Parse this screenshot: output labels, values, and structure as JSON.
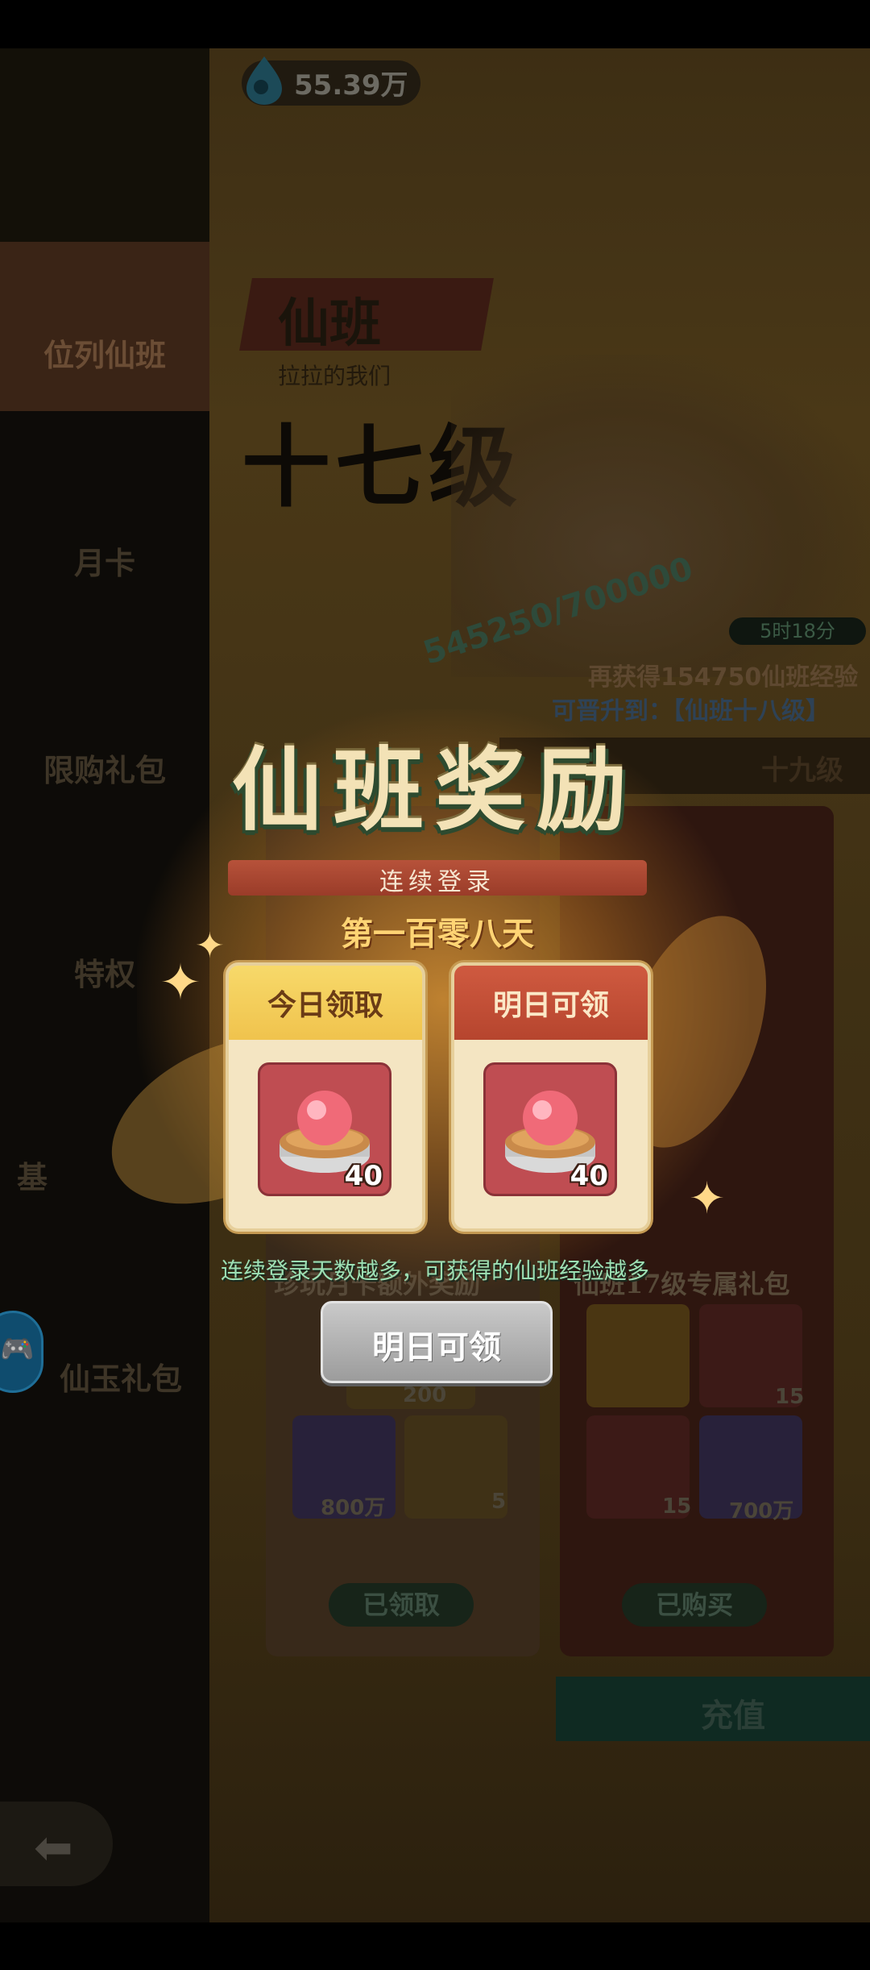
{
  "currency": {
    "value": "55.39万",
    "icon": "drop-icon"
  },
  "sidebar": {
    "items": [
      {
        "label": "位列仙班",
        "active": true
      },
      {
        "label": "月卡"
      },
      {
        "label": "限购礼包"
      },
      {
        "label": "特权"
      },
      {
        "label": "基"
      },
      {
        "label": "仙玉礼包"
      }
    ]
  },
  "background": {
    "title": "仙班",
    "subtitle": "拉拉的我们",
    "level": "十七级",
    "progress": "545250/700000",
    "timer": "5时18分",
    "exp_hint": "再获得154750仙班经验",
    "upgrade_hint": "可晋升到：【仙班十八级】",
    "level_right": "十九级",
    "left_panel_label": "珍玩月卡额外奖励",
    "right_panel_label": "仙班17级专属礼包",
    "left_items": [
      {
        "value": "200"
      },
      {
        "value": "800万"
      },
      {
        "value": "5"
      }
    ],
    "right_items": [
      {
        "value": ""
      },
      {
        "value": "15"
      },
      {
        "value": "15"
      },
      {
        "value": "700万"
      }
    ],
    "left_button": "已领取",
    "right_button": "已购买",
    "recharge": "充值"
  },
  "modal": {
    "title": "仙班奖励",
    "streak_label": "连续登录",
    "day_count": "第一百零八天",
    "cards": [
      {
        "label": "今日领取",
        "count": "40",
        "theme": "today"
      },
      {
        "label": "明日可领",
        "count": "40",
        "theme": "tomorrow"
      }
    ],
    "hint": "连续登录天数越多，可获得的仙班经验越多",
    "claim_button": "明日可领"
  },
  "colors": {
    "accent_gold": "#f0c34d",
    "accent_red": "#b6452e",
    "hint_green": "#9cdfb3",
    "button_disabled": "#b0b0b0"
  }
}
